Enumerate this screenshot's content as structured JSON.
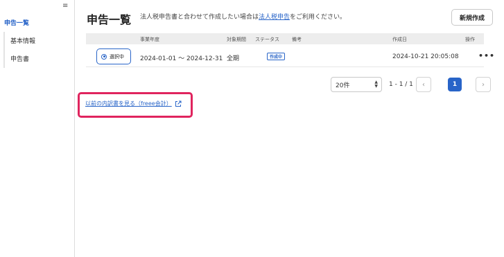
{
  "sidebar": {
    "collapse_icon": "≡",
    "active_item": "申告一覧",
    "items": [
      {
        "label": "基本情報"
      },
      {
        "label": "申告書"
      }
    ]
  },
  "header": {
    "title": "申告一覧",
    "desc_before": "法人税申告書と合わせて作成したい場合は",
    "desc_link": "法人税申告",
    "desc_after": "をご利用ください。",
    "new_button": "新規作成"
  },
  "table": {
    "columns": {
      "fiscal_year": "事業年度",
      "period": "対象期間",
      "status": "ステータス",
      "note": "備考",
      "created": "作成日",
      "actions": "操作"
    },
    "rows": [
      {
        "selected_label": "選択中",
        "fiscal_year": "2024-01-01 ～ 2024-12-31",
        "period": "全期",
        "status": "作成中",
        "note": "",
        "created": "2024-10-21 20:05:08",
        "menu": "•••"
      }
    ]
  },
  "pagination": {
    "per_page": "20件",
    "range": "1 - 1 / 1",
    "prev": "‹",
    "current": "1",
    "next": "›"
  },
  "old_link": "以前の内訳書を見る（freee会計）",
  "colors": {
    "accent": "#2864c8",
    "highlight": "#e0245e"
  }
}
